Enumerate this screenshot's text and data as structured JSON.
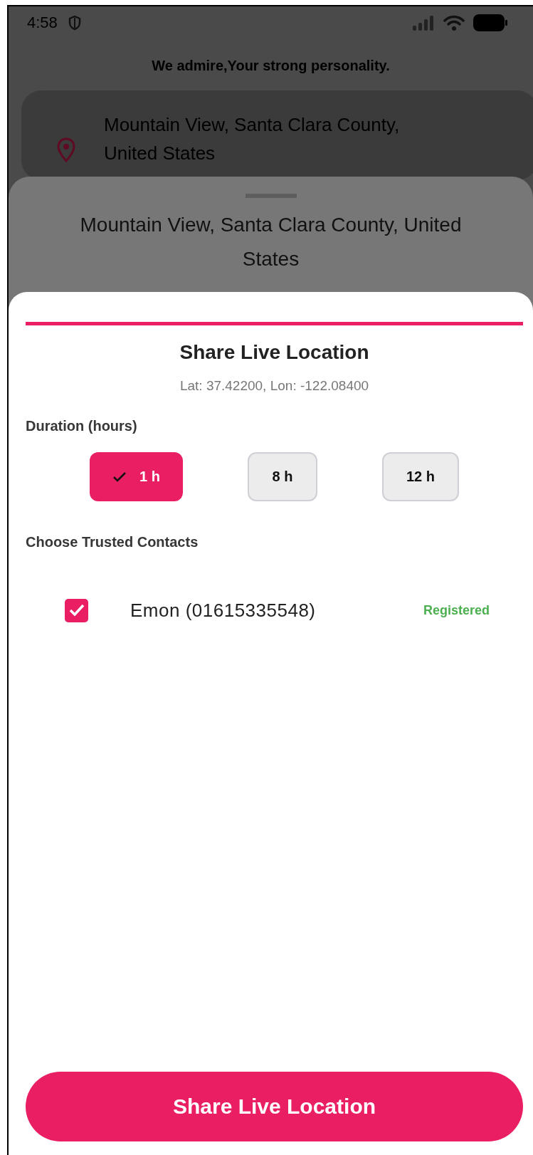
{
  "status_bar": {
    "time": "4:58"
  },
  "header": {
    "text": "We admire,Your strong personality."
  },
  "location_card": {
    "address": "Mountain View, Santa Clara County, United States"
  },
  "background_sheet": {
    "title": "Mountain View, Santa Clara County, United States"
  },
  "share_sheet": {
    "title": "Share Live Location",
    "coordinates": "Lat: 37.42200, Lon: -122.08400",
    "duration_label": "Duration (hours)",
    "durations": [
      {
        "label": "1 h",
        "selected": true
      },
      {
        "label": "8 h",
        "selected": false
      },
      {
        "label": "12 h",
        "selected": false
      }
    ],
    "contacts_label": "Choose Trusted Contacts",
    "contacts": [
      {
        "name": "Emon (01615335548)",
        "checked": true,
        "status": "Registered"
      }
    ],
    "button": "Share Live Location"
  }
}
